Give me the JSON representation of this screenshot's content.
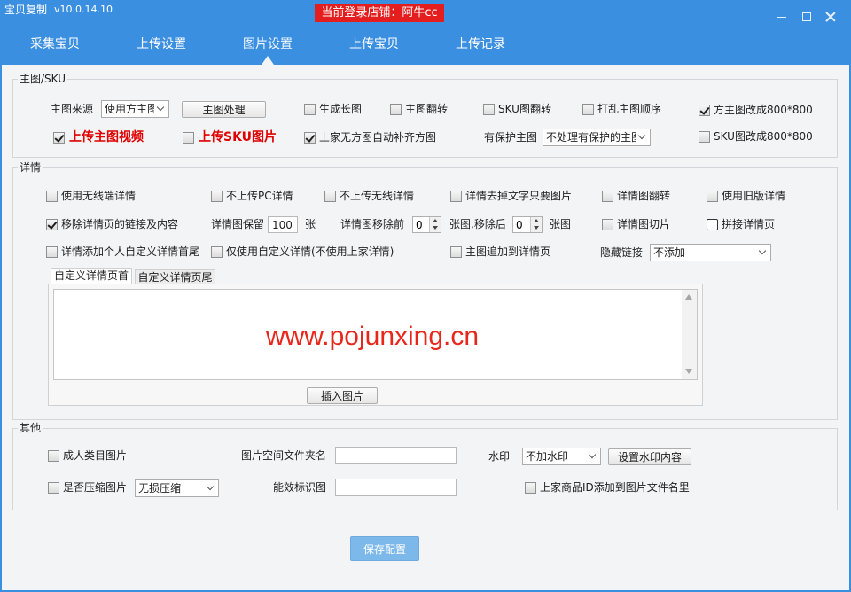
{
  "window": {
    "app_name": "宝贝复制",
    "version": "v10.0.14.10",
    "store_badge": "当前登录店铺：阿牛cc"
  },
  "icons": {
    "minimize": "minimize-icon",
    "maximize": "maximize-icon",
    "close": "close-icon",
    "dropdown": "chevron-down-icon"
  },
  "tabs": [
    {
      "label": "采集宝贝",
      "active": false
    },
    {
      "label": "上传设置",
      "active": false
    },
    {
      "label": "图片设置",
      "active": true
    },
    {
      "label": "上传宝贝",
      "active": false
    },
    {
      "label": "上传记录",
      "active": false
    }
  ],
  "main_sku": {
    "title": "主图/SKU",
    "source_label": "主图来源",
    "source_value": "使用方主图",
    "process_button": "主图处理",
    "generate_long": {
      "label": "生成长图",
      "checked": false
    },
    "flip_main": {
      "label": "主图翻转",
      "checked": false
    },
    "flip_sku": {
      "label": "SKU图翻转",
      "checked": false
    },
    "shuffle_main": {
      "label": "打乱主图顺序",
      "checked": false
    },
    "square_800": {
      "label": "方主图改成800*800",
      "checked": true
    },
    "upload_video": {
      "label": "上传主图视频",
      "checked": true
    },
    "upload_sku": {
      "label": "上传SKU图片",
      "checked": false
    },
    "auto_fill_square": {
      "label": "上家无方图自动补齐方图",
      "checked": true
    },
    "protected_label": "有保护主图",
    "protected_value": "不处理有保护的主图",
    "sku_800": {
      "label": "SKU图改成800*800",
      "checked": false
    }
  },
  "detail": {
    "title": "详情",
    "use_mobile": {
      "label": "使用无线端详情",
      "checked": false
    },
    "no_pc": {
      "label": "不上传PC详情",
      "checked": false
    },
    "no_mobile": {
      "label": "不上传无线详情",
      "checked": false
    },
    "remove_text": {
      "label": "详情去掉文字只要图片",
      "checked": false
    },
    "flip_detail": {
      "label": "详情图翻转",
      "checked": false
    },
    "old_detail": {
      "label": "使用旧版详情",
      "checked": false
    },
    "remove_links": {
      "label": "移除详情页的链接及内容",
      "checked": true
    },
    "keep_label": "详情图保留",
    "keep_value": "100",
    "keep_unit": "张",
    "remove_front_label": "详情图移除前",
    "remove_front_value": "0",
    "remove_back_label": "张图,移除后",
    "remove_back_value": "0",
    "remove_back_unit": "张图",
    "slice": {
      "label": "详情图切片",
      "checked": false
    },
    "stitch": {
      "label": "拼接详情页",
      "checked": false
    },
    "custom_head_tail": {
      "label": "详情添加个人自定义详情首尾",
      "checked": false
    },
    "custom_only": {
      "label": "仅使用自定义详情(不使用上家详情)",
      "checked": false
    },
    "append_main": {
      "label": "主图追加到详情页",
      "checked": false
    },
    "hide_link_label": "隐藏链接",
    "hide_link_value": "不添加",
    "subtabs": [
      {
        "label": "自定义详情页首",
        "active": true
      },
      {
        "label": "自定义详情页尾",
        "active": false
      }
    ],
    "insert_button": "插入图片"
  },
  "watermark_overlay": "www.pojunxing.cn",
  "other": {
    "title": "其他",
    "adult": {
      "label": "成人类目图片",
      "checked": false
    },
    "folder_label": "图片空间文件夹名",
    "folder_value": "",
    "watermark_label": "水印",
    "watermark_value": "不加水印",
    "watermark_button": "设置水印内容",
    "compress": {
      "label": "是否压缩图片",
      "checked": false
    },
    "compress_value": "无损压缩",
    "energy_label": "能效标识图",
    "energy_value": "",
    "add_id": {
      "label": "上家商品ID添加到图片文件名里",
      "checked": false
    }
  },
  "save_button": "保存配置",
  "colors": {
    "header": "#3b8fe0",
    "badge": "#e41e1e",
    "red": "#e00000",
    "save": "#7db8ea",
    "bg": "#f3f4f6"
  }
}
